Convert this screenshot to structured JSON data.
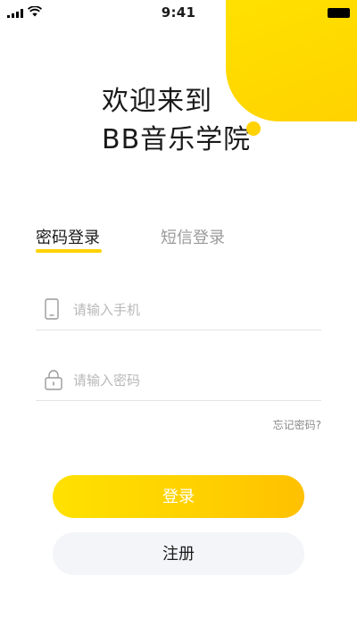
{
  "status_bar": {
    "time": "9:41"
  },
  "welcome": {
    "line1": "欢迎来到",
    "line2": "BB音乐学院"
  },
  "tabs": [
    {
      "label": "密码登录",
      "active": true
    },
    {
      "label": "短信登录",
      "active": false
    }
  ],
  "form": {
    "phone": {
      "placeholder": "请输入手机",
      "value": "",
      "icon": "phone-icon"
    },
    "password": {
      "placeholder": "请输入密码",
      "value": "",
      "icon": "lock-icon"
    },
    "forgot_label": "忘记密码?"
  },
  "buttons": {
    "login_label": "登录",
    "register_label": "注册"
  },
  "colors": {
    "accent": "#ffd200",
    "button_secondary_bg": "#f4f5f9"
  }
}
